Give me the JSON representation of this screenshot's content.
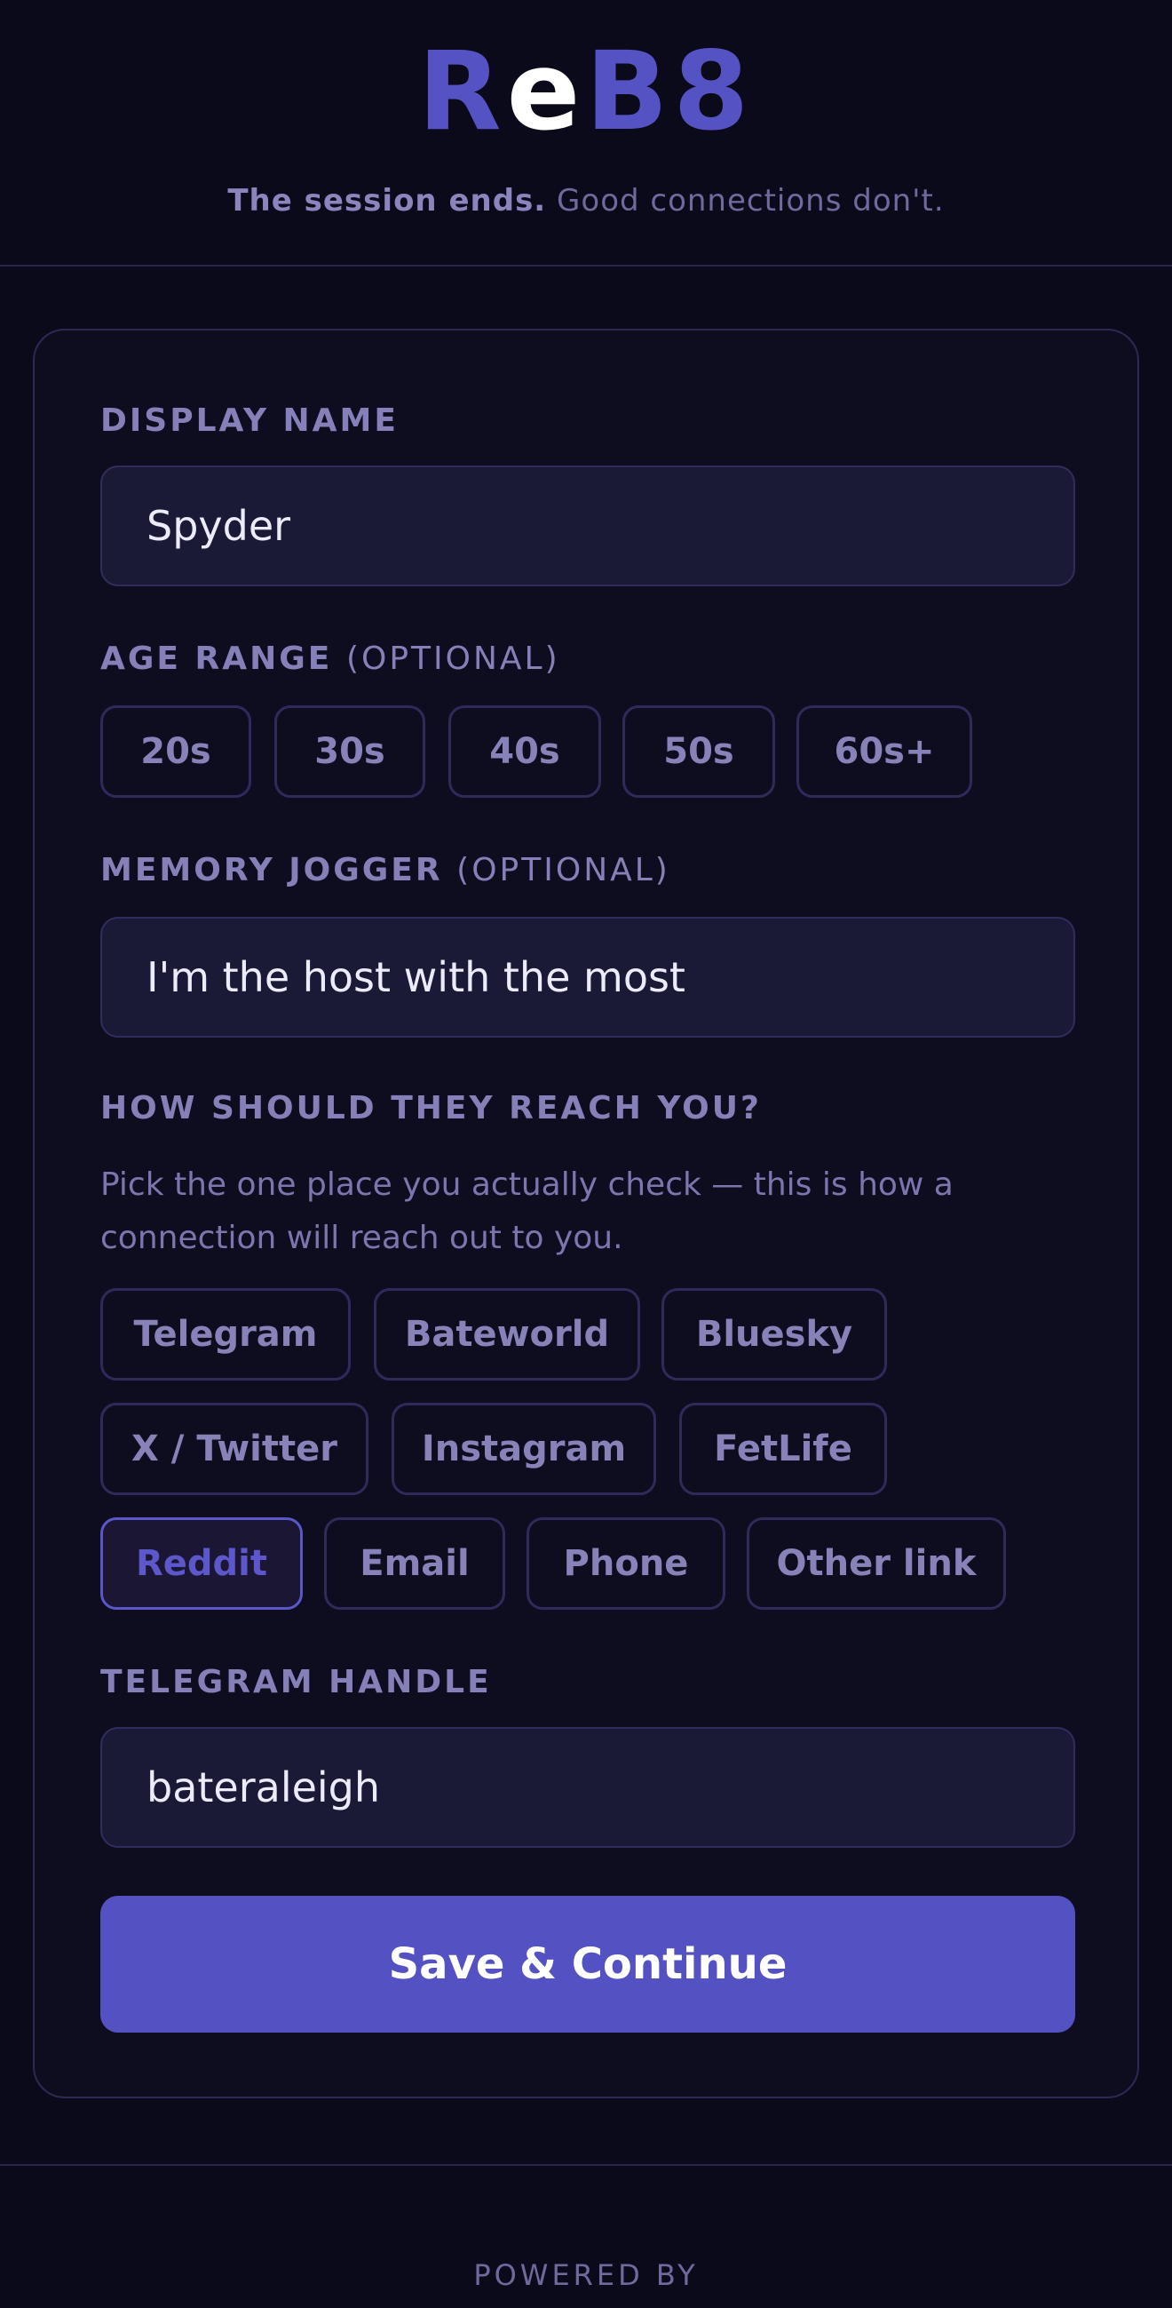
{
  "header": {
    "logo": {
      "part1": "R",
      "part2": "e",
      "part3": "B8"
    },
    "tagline_bold": "The session ends.",
    "tagline_rest": " Good connections don't."
  },
  "form": {
    "display_name": {
      "label": "DISPLAY NAME",
      "value": "Spyder"
    },
    "age_range": {
      "label": "AGE RANGE",
      "optional": "(OPTIONAL)",
      "options": [
        "20s",
        "30s",
        "40s",
        "50s",
        "60s+"
      ]
    },
    "memory_jogger": {
      "label": "MEMORY JOGGER",
      "optional": "(OPTIONAL)",
      "value": "I'm the host with the most"
    },
    "reach": {
      "label": "HOW SHOULD THEY REACH YOU?",
      "help": "Pick the one place you actually check — this is how a connection will reach out to you.",
      "options": [
        "Telegram",
        "Bateworld",
        "Bluesky",
        "X / Twitter",
        "Instagram",
        "FetLife",
        "Reddit",
        "Email",
        "Phone",
        "Other link"
      ],
      "selected": "Reddit"
    },
    "handle": {
      "label": "TELEGRAM HANDLE",
      "value": "bateraleigh"
    },
    "submit_label": "Save & Continue"
  },
  "footer": {
    "powered_by": "POWERED BY"
  },
  "colors": {
    "accent": "#5452c3",
    "background": "#0b0a1a",
    "card": "#0e0d20"
  }
}
